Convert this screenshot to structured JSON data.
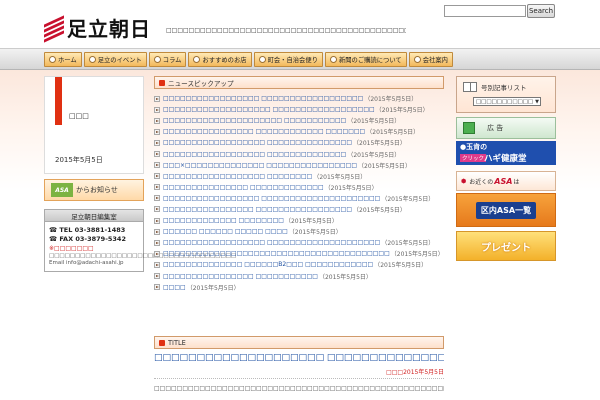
{
  "header": {
    "logo_text": "足立朝日",
    "tagline": "□□□□□□□□□□□□□□□□□□□□□□□□□□□□□□□□□□□□□□□□□□□□□□□□□□",
    "search_placeholder": "",
    "search_button": "Search"
  },
  "nav": {
    "items": [
      {
        "label": "ホーム"
      },
      {
        "label": "足立のイベント"
      },
      {
        "label": "コラム"
      },
      {
        "label": "おすすめのお店"
      },
      {
        "label": "町会・自治会便り"
      },
      {
        "label": "新聞のご購読について"
      },
      {
        "label": "会社案内"
      }
    ]
  },
  "left": {
    "feature_text": "□□□",
    "feature_date": "2015年5月5日",
    "asa_logo": "ASA",
    "asa_text": "からお知らせ",
    "office_title": "足立朝日編集室",
    "tel": "TEL 03-3881-1483",
    "fax": "FAX 03-3879-5342",
    "notice": "※□□□□□□□",
    "address": "□□□□□□□□□□□□□□□□□□□□□□□□□□□□□□□□□□□□",
    "email": "Email info@adachi-asahi.jp"
  },
  "main": {
    "section_title": "ニュースピックアップ",
    "news": [
      {
        "title": "□□□□□□□□□□□□□□□□□ □□□□□□□□□□□□□□□□□□",
        "date": "2015年5月5日"
      },
      {
        "title": "□□□□□□□□□□□□□□□□□□□ □□□□□□□□□□□□□□□□□□",
        "date": "2015年5月5日"
      },
      {
        "title": "□□□□□□□□□□□□□□□□□□□□□ □□□□□□□□□□□",
        "date": "2015年5月5日"
      },
      {
        "title": "□□□□□□□□□□□□□□□□ □□□□□□□□□□□□ □□□□□□□",
        "date": "2015年5月5日"
      },
      {
        "title": "□□□□□□□□□□□□□□□□□□ □□□□□□□□□□□□□□□",
        "date": "2015年5月5日"
      },
      {
        "title": "□□□□□□□□□□□□□□□□□□ □□□□□□□□□□□□□□",
        "date": "2015年5月5日"
      },
      {
        "title": "□□□×□□□□□□□□□□□□□□ □□□□□□□□□□□□□□□□",
        "date": "2015年5月5日"
      },
      {
        "title": "□□□□□□□□□□□□□□□□□□ □□□□□□□□",
        "date": "2015年5月5日"
      },
      {
        "title": "□□□□□□□□□□□□□□□ □□□□□□□□□□□□□",
        "date": "2015年5月5日"
      },
      {
        "title": "□□□□□□□□□□□□□□□□□ □□□□□□□□□□□□□□□□□□□□□",
        "date": "2015年5月5日"
      },
      {
        "title": "□□□□□□□□□□□□□□□□ □□□□□□□□□□□□□□□□□",
        "date": "2015年5月5日"
      },
      {
        "title": "□□□□□□□□□□□□□ □□□□□□□□",
        "date": "2015年5月5日"
      },
      {
        "title": "□□□□□□ □□□□□□ □□□□□ □□□□",
        "date": "2015年5月5日"
      },
      {
        "title": "□□□□□□□□□□□□□□□□□□ □□□□□□□□□□□□□□□□□□□□",
        "date": "2015年5月5日"
      },
      {
        "title": "□□□□□□□□□□□□□□□□□□□□□□□□□□□□□□□□□□□□□□□□",
        "date": "2015年5月5日"
      },
      {
        "title": "□□□□□□□□□□□□□□ □□□□□□B2□□□ □□□□□□□□□□□□",
        "date": "2015年5月5日"
      },
      {
        "title": "□□□□□□□□□□□□□□□□ □□□□□□□□□□□",
        "date": "2015年5月5日"
      },
      {
        "title": "□□□□",
        "date": "2015年5月5日"
      }
    ],
    "title_label": "TITLE",
    "article_title": "□□□□□□□□□□□□□□□□□□□□ □□□□□□□□□□□□□□□□□□□□",
    "article_date": "□□□2015年5月5日",
    "article_body": "□□□□□□□□□□□□□□□□□□□□□□□□□□□□□□□□□□□□□□□□□□□□□□□□□□□□□□□□□□□□"
  },
  "right": {
    "archive_label": "号別記事リスト",
    "archive_select": "□□□□□□□□□□□",
    "ad_label": "広 告",
    "haghi_top": "●玉肯の",
    "haghi_click": "クリック",
    "haghi_name": "ハギ健康堂",
    "near_prefix": "お近くの",
    "near_asa": "ASA",
    "near_suffix": "は",
    "kunai_label": "区内ASA一覧",
    "present_label": "プレゼント"
  }
}
